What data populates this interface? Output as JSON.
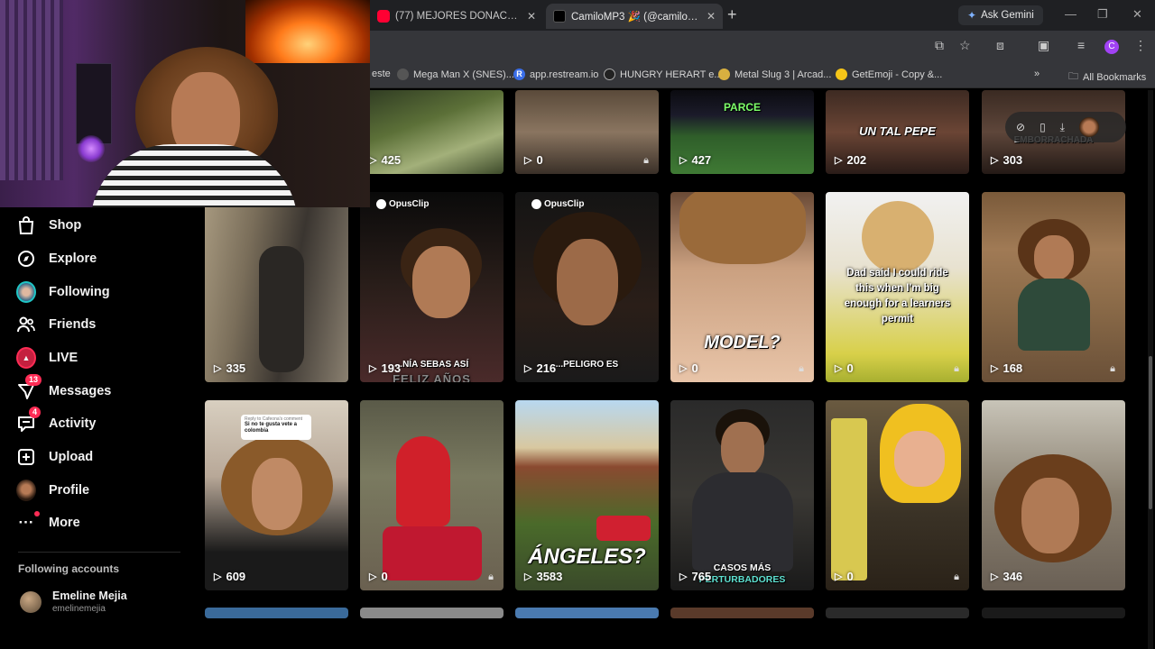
{
  "browser": {
    "tabs": [
      {
        "title": "(77) MEJORES DONACIONES DE",
        "active": false
      },
      {
        "title": "CamiloMP3 🎉 (@camilomp3) | TikTok",
        "active": true
      }
    ],
    "new_tab": "+",
    "ask_gemini": "Ask Gemini",
    "profile_initial": "C",
    "bookmarks": [
      {
        "label": "este"
      },
      {
        "label": "Mega Man X (SNES)..."
      },
      {
        "label": "app.restream.io"
      },
      {
        "label": "HUNGRY HERART e..."
      },
      {
        "label": "Metal Slug 3 | Arcad..."
      },
      {
        "label": "GetEmoji - Copy &..."
      }
    ],
    "more_bookmarks": "»",
    "all_bookmarks": "All Bookmarks"
  },
  "sidebar": {
    "items": [
      {
        "label": "Shop",
        "icon": "shopping-bag-icon"
      },
      {
        "label": "Explore",
        "icon": "compass-icon"
      },
      {
        "label": "Following",
        "icon": "following-avatar"
      },
      {
        "label": "Friends",
        "icon": "friends-icon"
      },
      {
        "label": "LIVE",
        "icon": "live-icon"
      },
      {
        "label": "Messages",
        "icon": "messages-icon",
        "badge": "13"
      },
      {
        "label": "Activity",
        "icon": "activity-icon",
        "badge": "4"
      },
      {
        "label": "Upload",
        "icon": "upload-icon"
      },
      {
        "label": "Profile",
        "icon": "profile-avatar"
      },
      {
        "label": "More",
        "icon": "more-icon"
      }
    ],
    "following_accounts_title": "Following accounts",
    "account": {
      "name": "Emeline Mejia",
      "handle": "emelinemejia"
    }
  },
  "videos": {
    "row1": [
      {
        "views": "425",
        "locked": false
      },
      {
        "views": "0",
        "locked": true
      },
      {
        "views": "427",
        "locked": false,
        "overlay": "PARCE"
      },
      {
        "views": "202",
        "locked": false,
        "overlay": "UN TAL PEPE"
      },
      {
        "views": "303",
        "locked": false,
        "overlay": "EMBORRACHADA"
      }
    ],
    "row2": [
      {
        "views": "335",
        "locked": false
      },
      {
        "views": "193",
        "locked": false,
        "overlay": "...NÍA SEBAS ASÍ",
        "subtext": "FELIZ AÑOS",
        "opus": "OpusClip"
      },
      {
        "views": "216",
        "locked": false,
        "overlay": "...PELIGRO ES",
        "opus": "OpusClip"
      },
      {
        "views": "0",
        "locked": true,
        "overlay": "MODEL?"
      },
      {
        "views": "0",
        "locked": true,
        "overlay": "Dad said I could ride this when I'm big enough for a learners permit"
      },
      {
        "views": "168",
        "locked": true
      }
    ],
    "row3": [
      {
        "views": "609",
        "locked": false,
        "comment_user": "Reply to Cafeona's comment",
        "comment_text": "Si no te gusta vete a colombia"
      },
      {
        "views": "0",
        "locked": true
      },
      {
        "views": "3583",
        "locked": false,
        "overlay": "ÁNGELES?"
      },
      {
        "views": "765",
        "locked": false,
        "overlay": "CASOS MÁS",
        "subtext": "PERTURBADORES"
      },
      {
        "views": "0",
        "locked": true
      },
      {
        "views": "346",
        "locked": false
      }
    ]
  },
  "colors": {
    "accent": "#fe2c55",
    "background": "#000000",
    "browser_chrome": "#35363a"
  }
}
